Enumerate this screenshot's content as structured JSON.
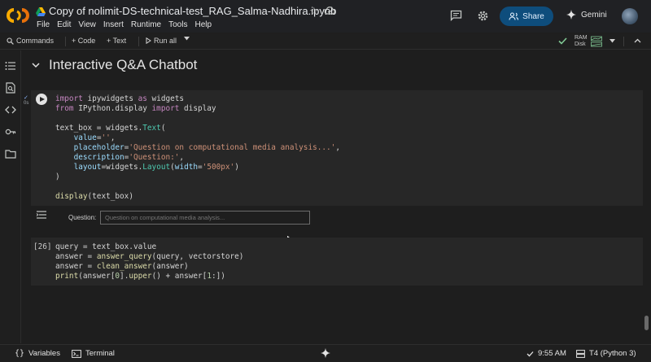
{
  "header": {
    "title": "Copy of nolimit-DS-technical-test_RAG_Salma-Nadhira.ipynb",
    "menu": [
      "File",
      "Edit",
      "View",
      "Insert",
      "Runtime",
      "Tools",
      "Help"
    ],
    "share_label": "Share",
    "gemini_label": "Gemini"
  },
  "toolbar": {
    "commands": "Commands",
    "add_code": "+ Code",
    "add_text": "+ Text",
    "run_all": "Run all",
    "ram_label": "RAM",
    "disk_label": "Disk"
  },
  "section": {
    "title": "Interactive Q&A Chatbot"
  },
  "cell1": {
    "status_time": "0s"
  },
  "output": {
    "label": "Question:",
    "placeholder": "Question on computational media analysis..."
  },
  "cell2": {
    "exec_count": "[26]"
  },
  "statusbar": {
    "variables": "Variables",
    "terminal": "Terminal",
    "time": "9:55 AM",
    "runtime": "T4 (Python 3)"
  },
  "colors": {
    "share_bg": "#0e4d7c",
    "accent_blue": "#8ab4f8",
    "check_green": "#81c995"
  }
}
